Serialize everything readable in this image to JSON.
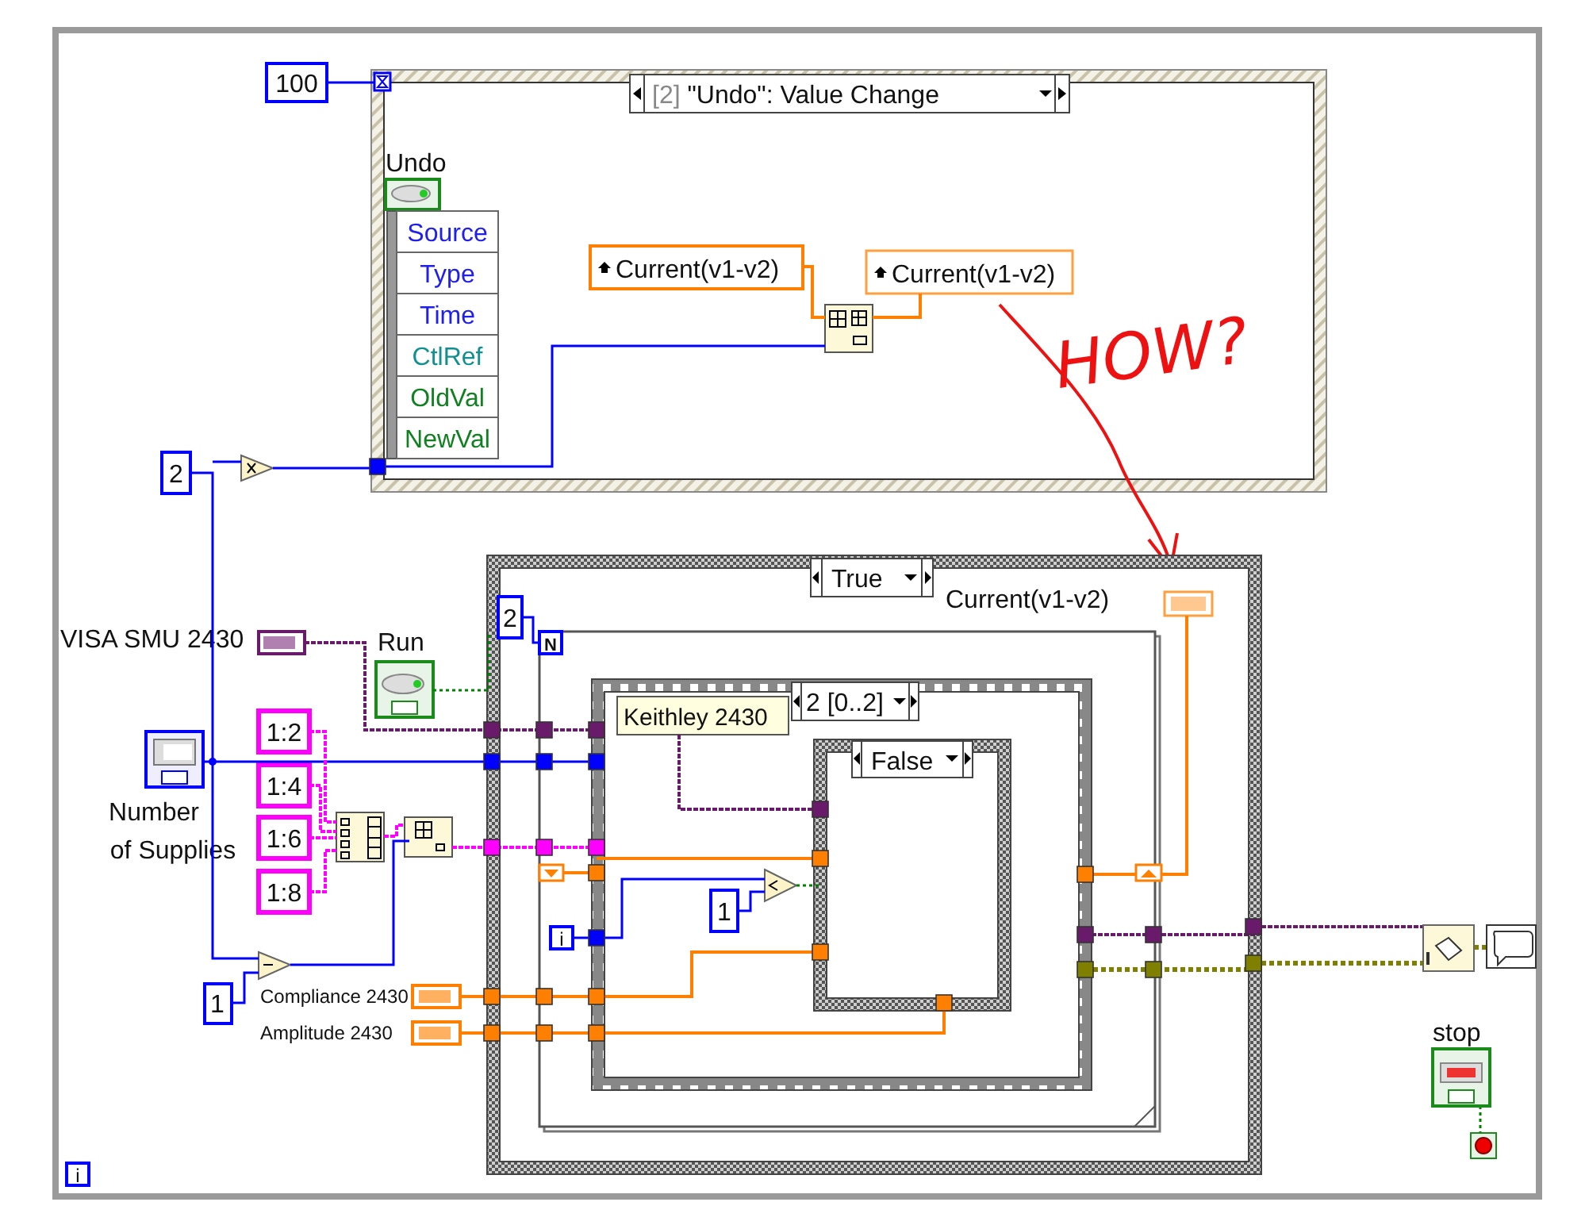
{
  "while_loop": {
    "iteration_terminal": "i"
  },
  "event_structure": {
    "timeout_constant": "100",
    "case_index": "[2]",
    "case_name": "\"Undo\": Value Change",
    "control_label": "Undo",
    "event_data": [
      {
        "name": "Source",
        "color": "#2020ee"
      },
      {
        "name": "Type",
        "color": "#2020ee"
      },
      {
        "name": "Time",
        "color": "#2020ee"
      },
      {
        "name": "CtlRef",
        "color": "#119090"
      },
      {
        "name": "OldVal",
        "color": "#108020"
      },
      {
        "name": "NewVal",
        "color": "#108020"
      }
    ],
    "read_local": "Current(v1-v2)",
    "write_local": "Current(v1-v2)"
  },
  "annotation": "HOW?",
  "multiplier_constant": "2",
  "visa_label": "VISA SMU 2430",
  "run_label": "Run",
  "supplies_label": [
    "Number",
    "of Supplies"
  ],
  "ratio_constants": [
    "1:2",
    "1:4",
    "1:6",
    "1:8"
  ],
  "subtract_constant": "1",
  "inputs": [
    {
      "label": "Compliance 2430"
    },
    {
      "label": "Amplitude 2430"
    }
  ],
  "case_structure": {
    "selector": "True",
    "indicator_label": "Current(v1-v2)",
    "count_constant": "2",
    "count_terminal": "N",
    "iteration_terminal": "i",
    "sequence": {
      "selector": "2 [0..2]",
      "label": "Keithley 2430",
      "inner_case": {
        "selector": "False",
        "compare_constant": "1"
      }
    }
  },
  "stop_label": "stop"
}
